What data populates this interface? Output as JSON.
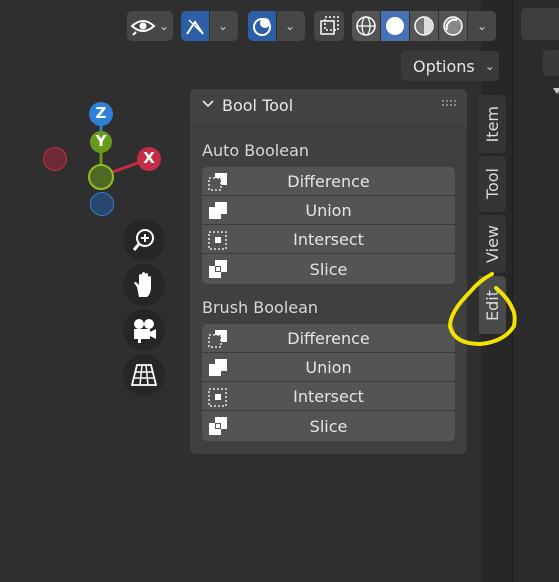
{
  "header": {
    "options_label": "Options",
    "chevron": "⌄"
  },
  "gizmo": {
    "z_label": "Z",
    "y_label": "Y",
    "x_label": "X",
    "colors": {
      "x": "#c42d47",
      "y": "#6a9a1c",
      "z": "#2e7fd6"
    }
  },
  "panel": {
    "title": "Bool Tool",
    "sections": [
      {
        "label": "Auto Boolean",
        "buttons": [
          "Difference",
          "Union",
          "Intersect",
          "Slice"
        ]
      },
      {
        "label": "Brush Boolean",
        "buttons": [
          "Difference",
          "Union",
          "Intersect",
          "Slice"
        ]
      }
    ]
  },
  "tabs": [
    "Item",
    "Tool",
    "View",
    "Edit"
  ],
  "icons": {
    "header": [
      "visibility-icon",
      "gizmo-icon",
      "overlay-icon",
      "xray-icon",
      "wireframe-shading-icon",
      "solid-shading-icon",
      "material-shading-icon",
      "rendered-shading-icon"
    ],
    "nav": [
      "zoom-icon",
      "pan-hand-icon",
      "camera-icon",
      "perspective-grid-icon"
    ]
  },
  "annotation_color": "#f3e300"
}
